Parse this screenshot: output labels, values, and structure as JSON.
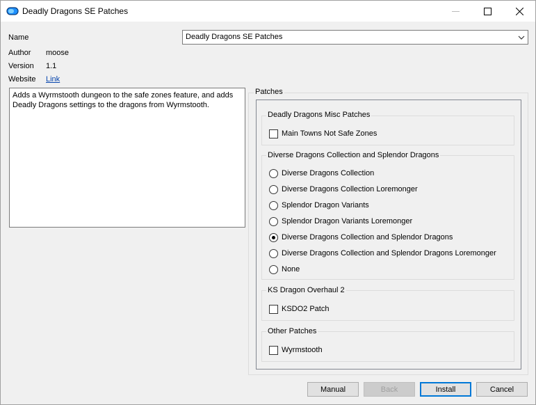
{
  "window": {
    "title": "Deadly Dragons SE Patches"
  },
  "info": {
    "name_label": "Name",
    "name_value": "Deadly Dragons SE Patches",
    "author_label": "Author",
    "author_value": "moose",
    "version_label": "Version",
    "version_value": "1.1",
    "website_label": "Website",
    "website_link": "Link",
    "description": "Adds a Wyrmstooth dungeon to the safe zones feature, and adds\nDeadly Dragons settings to the dragons from Wyrmstooth."
  },
  "patches": {
    "title": "Patches",
    "groups": [
      {
        "title": "Deadly Dragons Misc Patches",
        "options": [
          {
            "label": "Main Towns Not Safe Zones",
            "type": "checkbox",
            "checked": false
          }
        ]
      },
      {
        "title": "Diverse Dragons Collection and Splendor Dragons",
        "options": [
          {
            "label": "Diverse Dragons Collection",
            "type": "radio",
            "checked": false
          },
          {
            "label": "Diverse Dragons Collection Loremonger",
            "type": "radio",
            "checked": false
          },
          {
            "label": "Splendor Dragon Variants",
            "type": "radio",
            "checked": false
          },
          {
            "label": "Splendor Dragon Variants Loremonger",
            "type": "radio",
            "checked": false
          },
          {
            "label": "Diverse Dragons Collection and Splendor Dragons",
            "type": "radio",
            "checked": true
          },
          {
            "label": "Diverse Dragons Collection and Splendor Dragons Loremonger",
            "type": "radio",
            "checked": false
          },
          {
            "label": "None",
            "type": "radio",
            "checked": false
          }
        ]
      },
      {
        "title": "KS Dragon Overhaul 2",
        "options": [
          {
            "label": "KSDO2 Patch",
            "type": "checkbox",
            "checked": false
          }
        ]
      },
      {
        "title": "Other Patches",
        "options": [
          {
            "label": "Wyrmstooth",
            "type": "checkbox",
            "checked": false
          }
        ]
      }
    ]
  },
  "buttons": {
    "manual": "Manual",
    "back": "Back",
    "install": "Install",
    "cancel": "Cancel"
  },
  "colors": {
    "accent": "#0078d7",
    "link": "#0645ad"
  }
}
